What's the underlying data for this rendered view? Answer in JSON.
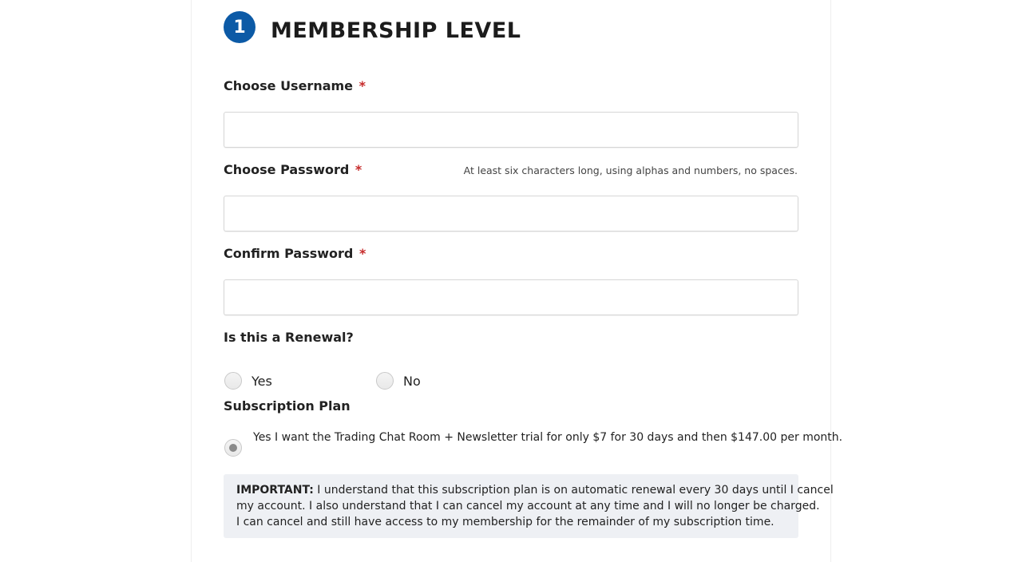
{
  "section": {
    "step_number": "1",
    "title": "MEMBERSHIP LEVEL"
  },
  "fields": {
    "username": {
      "label": "Choose Username",
      "required_mark": "*",
      "value": ""
    },
    "password": {
      "label": "Choose Password",
      "required_mark": "*",
      "hint": "At least six characters long, using alphas and numbers, no spaces.",
      "value": ""
    },
    "confirm_password": {
      "label": "Confirm Password",
      "required_mark": "*",
      "value": ""
    }
  },
  "renewal": {
    "label": "Is this a Renewal?",
    "options": [
      {
        "label": "Yes",
        "selected": false
      },
      {
        "label": "No",
        "selected": false
      }
    ]
  },
  "subscription": {
    "label": "Subscription Plan",
    "plan_text": "Yes I want the Trading Chat Room + Newsletter trial for only $7 for 30 days and then $147.00 per month.",
    "selected": true
  },
  "notice": {
    "strong": "IMPORTANT:",
    "line1": " I understand that this subscription plan is on automatic renewal every 30 days until I cancel",
    "line2": "my account. I also understand that I can cancel my account at any time and I will no longer be charged.",
    "line3": "I can cancel and still have access to my membership for the remainder of my subscription time."
  },
  "colors": {
    "accent": "#0c5aa6",
    "required": "#c62a2a",
    "notice_bg": "#eef0f4"
  }
}
